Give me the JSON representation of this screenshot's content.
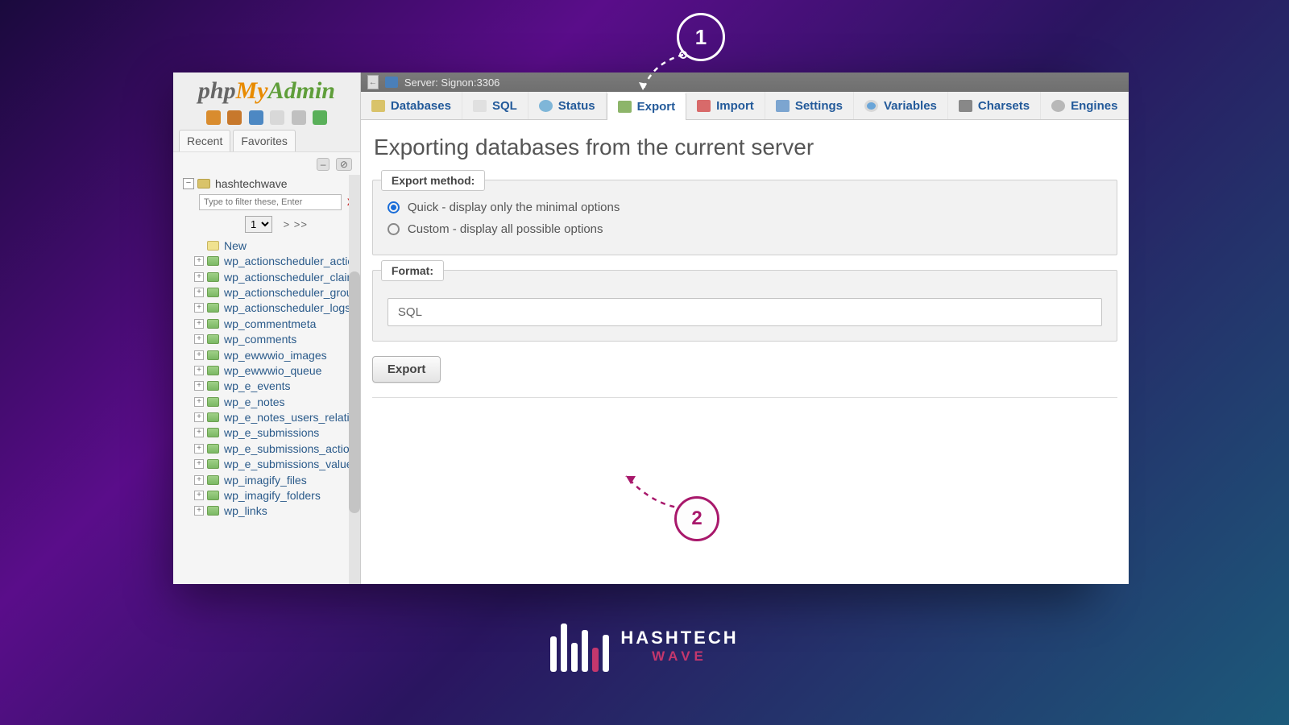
{
  "annotation": {
    "step1": "1",
    "step2": "2"
  },
  "logo": {
    "php": "php",
    "my": "My",
    "admin": "Admin"
  },
  "sidebar_tabs": {
    "recent": "Recent",
    "favorites": "Favorites"
  },
  "tree_tools": {
    "collapse": "–",
    "unlink": "⊘"
  },
  "database": {
    "name": "hashtechwave"
  },
  "filter": {
    "placeholder": "Type to filter these, Enter",
    "clear": "X"
  },
  "pagination": {
    "current": "1",
    "next": "> >>"
  },
  "new_label": "New",
  "tables": [
    "wp_actionscheduler_action",
    "wp_actionscheduler_claim",
    "wp_actionscheduler_group",
    "wp_actionscheduler_logs",
    "wp_commentmeta",
    "wp_comments",
    "wp_ewwwio_images",
    "wp_ewwwio_queue",
    "wp_e_events",
    "wp_e_notes",
    "wp_e_notes_users_relatio",
    "wp_e_submissions",
    "wp_e_submissions_action",
    "wp_e_submissions_values",
    "wp_imagify_files",
    "wp_imagify_folders",
    "wp_links"
  ],
  "server_bar": {
    "label": "Server: Signon:3306"
  },
  "nav": {
    "databases": "Databases",
    "sql": "SQL",
    "status": "Status",
    "export": "Export",
    "import": "Import",
    "settings": "Settings",
    "variables": "Variables",
    "charsets": "Charsets",
    "engines": "Engines"
  },
  "page": {
    "title": "Exporting databases from the current server"
  },
  "export_method": {
    "legend": "Export method:",
    "quick": "Quick - display only the minimal options",
    "custom": "Custom - display all possible options"
  },
  "format": {
    "legend": "Format:",
    "value": "SQL"
  },
  "export_button": "Export",
  "brand": {
    "line1": "HASHTECH",
    "line2": "WAVE"
  }
}
